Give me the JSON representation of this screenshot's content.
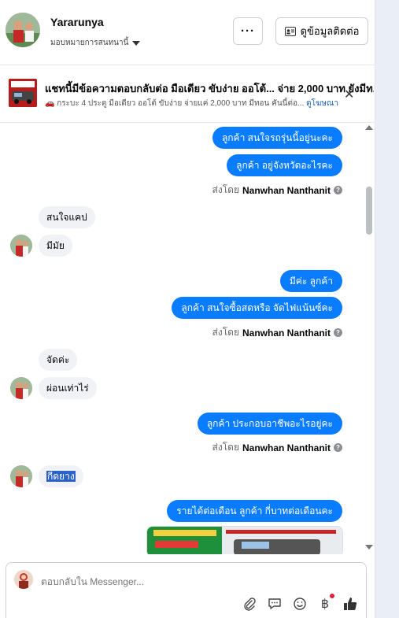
{
  "header": {
    "name": "Yararunya",
    "assign_label": "มอบหมายการสนทนานี้",
    "more_label": "···",
    "contact_label": "ดูข้อมูลติดต่อ"
  },
  "ad": {
    "title": "แชทนี้มีข้อความตอบกลับต่อ มือเดียว ขับง่าย ออโต้... จ่าย 2,000 บาท ยังมีท...",
    "subtitle": "🚗 กระบะ 4 ประตู มือเดียว ออโต้ ขับง่าย จ่ายแค่ 2,000 บาท มีทอน คันนี้ต่อ...",
    "link_label": "ดูโฆษณา",
    "close_label": "✕"
  },
  "messages": {
    "m1": "ลูกค้า สนใจรถรุ่นนี้อยู่นะคะ",
    "m2": "ลูกค้า อยู่จังหวัดอะไรคะ",
    "sent_by_prefix": "ส่งโดย",
    "sent_by_name": "Nanwhan Nanthanit",
    "m3": "สนใจแคป",
    "m4": "มีมัย",
    "m5": "มีค่ะ  ลูกค้า",
    "m6": "ลูกค้า สนใจซื้อสดหรือ จัดไฟแน้นซ์คะ",
    "m7": "จัดค่ะ",
    "m8": "ผ่อนเท่าไร่",
    "m9": "ลูกค้า ประกอบอาชีพอะไรอยู่คะ",
    "m10": "กีดยาง",
    "m11": "รายได้ต่อเดือน  ลูกค้า กี่บาทต่อเดือนคะ"
  },
  "composer": {
    "placeholder": "ตอบกลับใน Messenger..."
  },
  "colors": {
    "accent": "#0a7cff",
    "incoming_bg": "#f0f2f5",
    "highlight": "#2d63c8"
  },
  "icons": {
    "attach": "paperclip-icon",
    "reply": "chat-bubble-icon",
    "emoji": "smile-icon",
    "payment": "baht-icon",
    "like": "thumbs-up-icon"
  }
}
